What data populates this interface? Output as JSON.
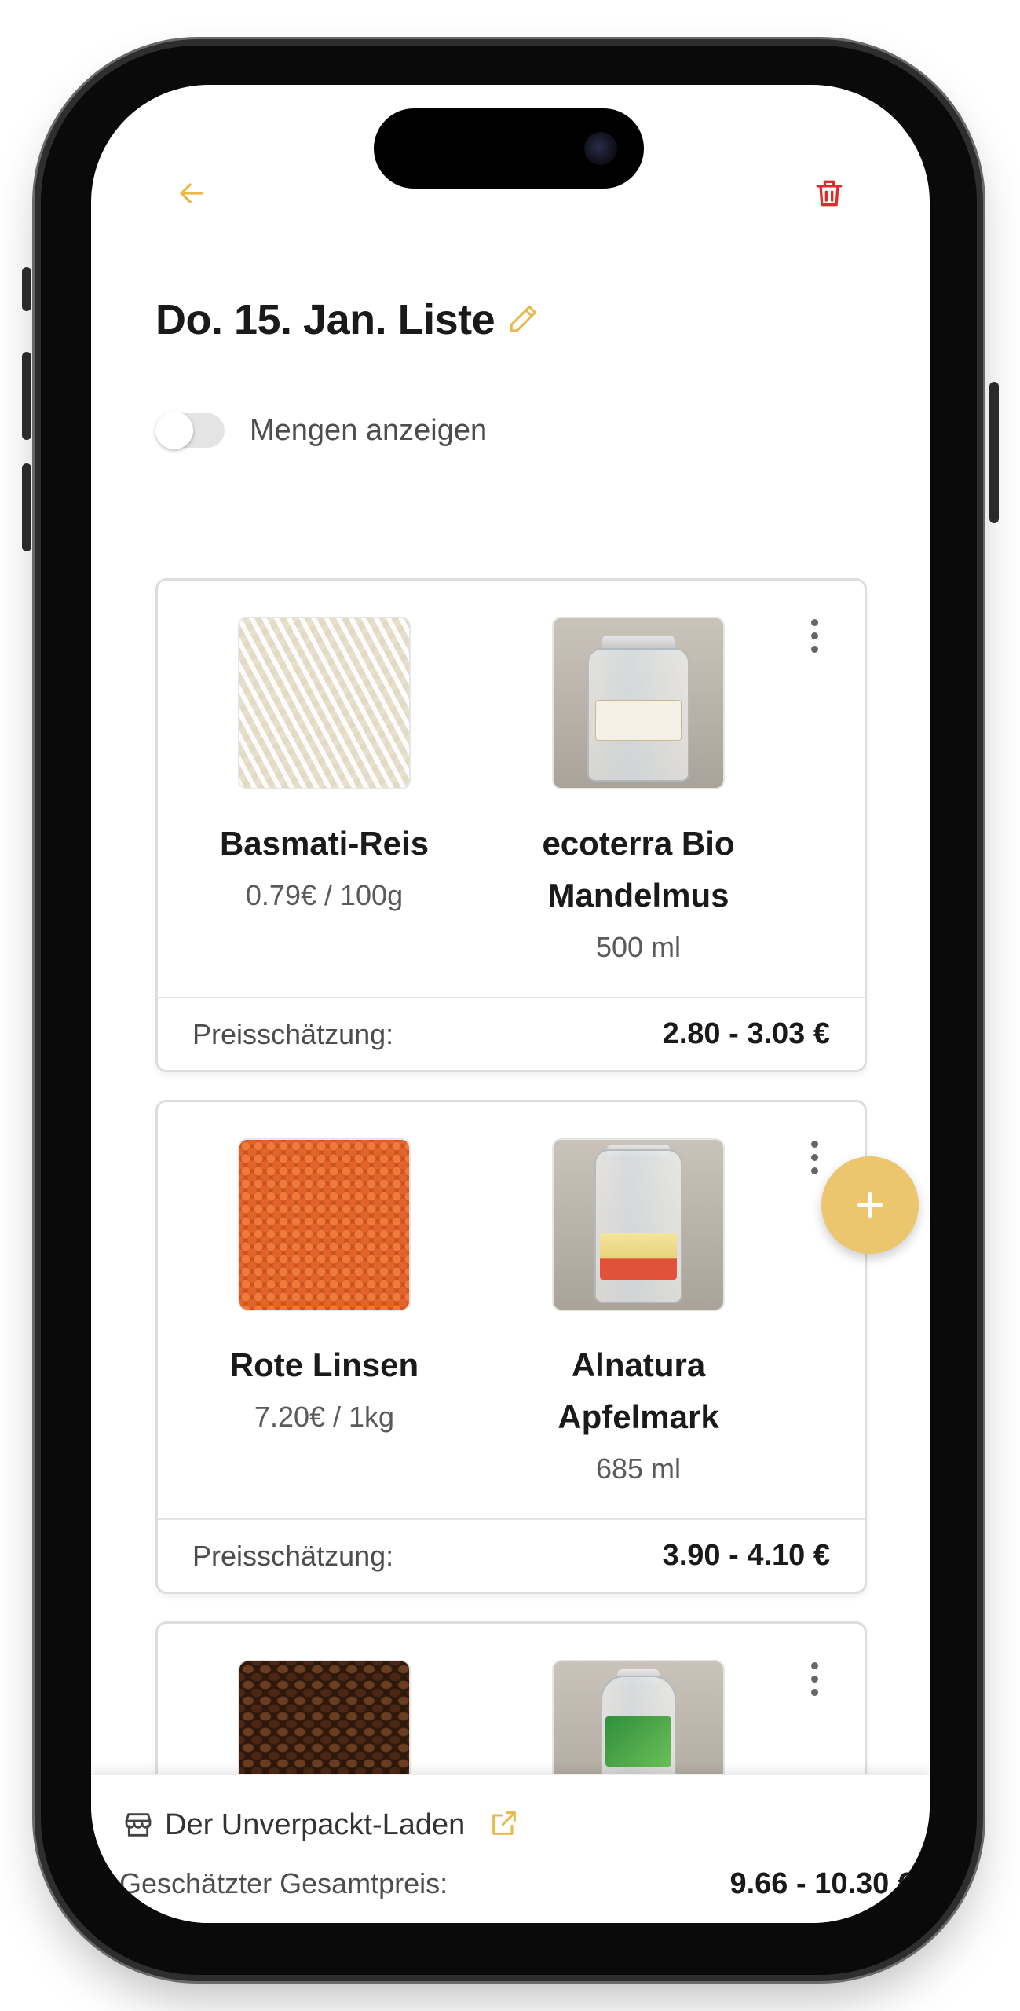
{
  "header": {
    "title": "Do. 15. Jan. Liste"
  },
  "toggle": {
    "label": "Mengen anzeigen",
    "on": false
  },
  "cards": [
    {
      "items": [
        {
          "name": "Basmati-Reis",
          "sub": "0.79€ / 100g",
          "image": "rice"
        },
        {
          "name": "ecoterra Bio Mandelmus",
          "sub": "500 ml",
          "image": "almond-butter-jar"
        }
      ],
      "estimate_label": "Preisschätzung:",
      "estimate_value": "2.80 - 3.03 €"
    },
    {
      "items": [
        {
          "name": "Rote Linsen",
          "sub": "7.20€ / 1kg",
          "image": "red-lentils"
        },
        {
          "name": "Alnatura Apfelmark",
          "sub": "685 ml",
          "image": "applesauce-jar"
        }
      ],
      "estimate_label": "Preisschätzung:",
      "estimate_value": "3.90 - 4.10 €"
    },
    {
      "items": [
        {
          "name": "",
          "sub": "",
          "image": "coffee-beans"
        },
        {
          "name": "",
          "sub": "",
          "image": "glass-bottle"
        }
      ]
    }
  ],
  "footer": {
    "shop_name": "Der Unverpackt-Laden",
    "total_label": "Geschätzter Gesamtpreis:",
    "total_value": "9.66 - 10.30 €"
  },
  "colors": {
    "accent": "#e8b84a",
    "fab": "#ecc66c",
    "delete": "#e02a2a",
    "text": "#1a1a1a",
    "muted": "#4d4d4d"
  },
  "icons": [
    "arrow-left-icon",
    "trash-icon",
    "pencil-icon",
    "more-vertical-icon",
    "plus-icon",
    "store-icon",
    "external-link-icon"
  ]
}
